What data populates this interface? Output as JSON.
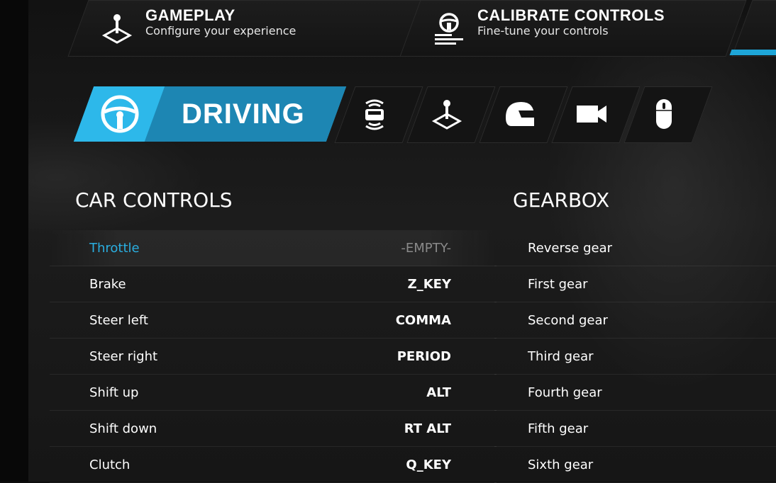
{
  "top_tabs": [
    {
      "title": "GAMEPLAY",
      "subtitle": "Configure your experience",
      "icon": "joystick-icon"
    },
    {
      "title": "CALIBRATE CONTROLS",
      "subtitle": "Fine-tune your controls",
      "icon": "steering-wheel-icon"
    }
  ],
  "categories": {
    "active_label": "DRIVING",
    "icons": [
      "steering-wheel-icon",
      "car-sensors-icon",
      "joystick-icon",
      "helmet-icon",
      "camera-icon",
      "mouse-icon"
    ]
  },
  "car_controls": {
    "title": "CAR CONTROLS",
    "rows": [
      {
        "name": "Throttle",
        "key": "-EMPTY-"
      },
      {
        "name": "Brake",
        "key": "Z_KEY"
      },
      {
        "name": "Steer left",
        "key": "COMMA"
      },
      {
        "name": "Steer right",
        "key": "PERIOD"
      },
      {
        "name": "Shift up",
        "key": "ALT"
      },
      {
        "name": "Shift down",
        "key": "RT ALT"
      },
      {
        "name": "Clutch",
        "key": "Q_KEY"
      }
    ]
  },
  "gearbox": {
    "title": "GEARBOX",
    "rows": [
      "Reverse gear",
      "First gear",
      "Second gear",
      "Third gear",
      "Fourth gear",
      "Fifth gear",
      "Sixth gear"
    ]
  },
  "colors": {
    "accent": "#2aaee0",
    "active_tab": "#1d86b3"
  }
}
